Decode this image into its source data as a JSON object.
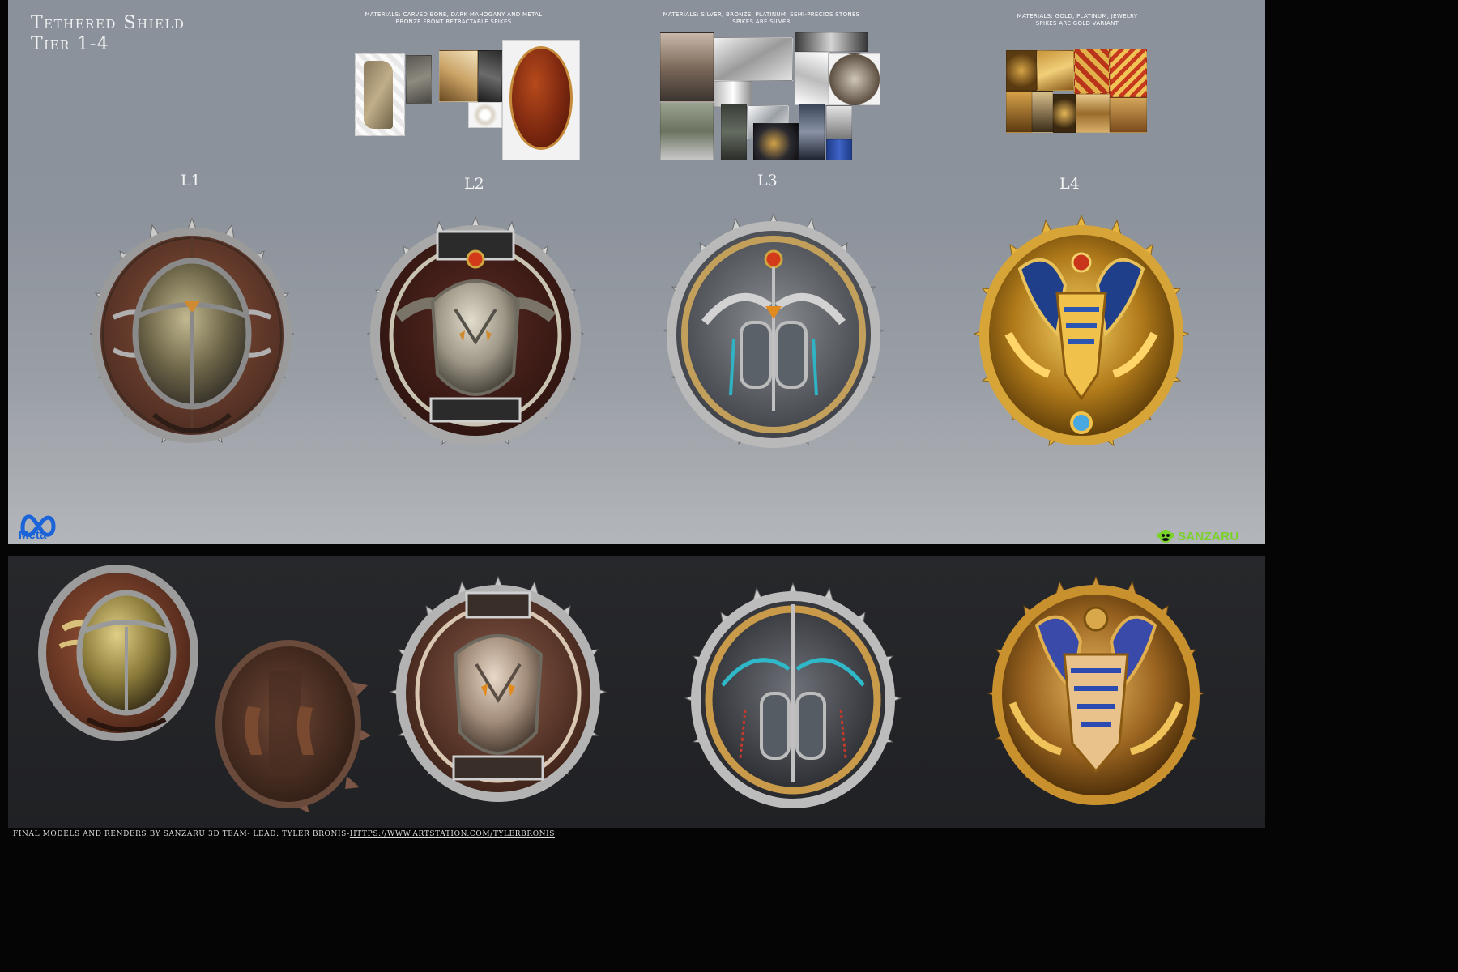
{
  "sheet": {
    "title": "Tethered Shield",
    "subtitle": "Tier 1-4"
  },
  "materials": {
    "l2": [
      "Materials: Carved bone, dark mahogany and metal",
      "Bronze front retractable spikes"
    ],
    "l3": [
      "Materials: Silver, bronze, platinum, semi-precios stones",
      "Spikes are silver"
    ],
    "l4": [
      "Materials: Gold, platinum, jewelry",
      "spikes are gold variant"
    ]
  },
  "levels": [
    "L1",
    "L2",
    "L3",
    "L4"
  ],
  "logos": {
    "meta": "Meta",
    "sanzaru": "SANZARU"
  },
  "credits": {
    "text": "Final models and renders by Sanzaru 3D Team- Lead: Tyler Bronis-",
    "link": "https://www.artstation.com/tylerbronis"
  },
  "colors": {
    "background": "#050505",
    "concept_panel": "#8d939c",
    "render_panel": "#232427",
    "meta_blue": "#1b63d9",
    "sanzaru_green": "#7bd22a"
  }
}
